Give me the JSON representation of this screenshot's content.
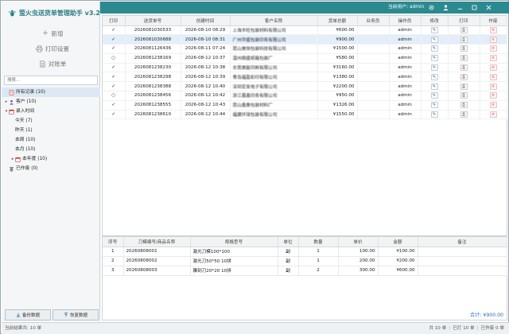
{
  "app": {
    "title": "萤火虫送货单管理助手 v3.2",
    "current_user_label": "当前用户: admin"
  },
  "sidebar": {
    "new_label": "新增",
    "print_settings_label": "打印设置",
    "statement_label": "对账单",
    "search_placeholder": "搜索...",
    "tree": [
      {
        "label": "所有记录 (10)",
        "level": 0,
        "icon": "note-icon",
        "twisty": "",
        "selected": true
      },
      {
        "label": "客户 (10)",
        "level": 0,
        "icon": "person-icon",
        "twisty": "▸",
        "selected": false
      },
      {
        "label": "录入时间",
        "level": 0,
        "icon": "calendar-icon",
        "twisty": "▾",
        "selected": false
      },
      {
        "label": "今天 (7)",
        "level": 1,
        "icon": "",
        "twisty": "",
        "selected": false
      },
      {
        "label": "昨天 (1)",
        "level": 1,
        "icon": "",
        "twisty": "",
        "selected": false
      },
      {
        "label": "本周 (10)",
        "level": 1,
        "icon": "",
        "twisty": "",
        "selected": false
      },
      {
        "label": "本月 (10)",
        "level": 1,
        "icon": "",
        "twisty": "",
        "selected": false
      },
      {
        "label": "本年度 (10)",
        "level": 1,
        "icon": "calendar-icon",
        "twisty": "▸",
        "selected": false
      },
      {
        "label": "已作废 (0)",
        "level": 0,
        "icon": "trash-icon",
        "twisty": "",
        "selected": false
      }
    ],
    "backup_label": "备份数据",
    "restore_label": "恢复数据"
  },
  "main_table": {
    "columns": [
      "打印",
      "送货单号",
      "创建时间",
      "客户名称",
      "货单总额",
      "业务员",
      "操作员",
      "修改",
      "打印",
      "作废"
    ],
    "rows": [
      {
        "printed": "✓",
        "no": "2026081030533",
        "time": "2026-08-10 08:29",
        "customer": "上海丰旺包装材料有限公司",
        "amount": "¥600.00",
        "sales": "",
        "operator": "admin",
        "highlight": false
      },
      {
        "printed": "✓",
        "no": "2026081030688",
        "time": "2026-08-10 08:31",
        "customer": "广州华盛包装印务有限公司",
        "amount": "¥900.00",
        "sales": "",
        "operator": "admin",
        "highlight": true
      },
      {
        "printed": "✓",
        "no": "2026081126436",
        "time": "2026-08-11 07:24",
        "customer": "昆山美恒包装科技有限公司",
        "amount": "¥1500.00",
        "sales": "",
        "operator": "admin",
        "highlight": false
      },
      {
        "printed": "○",
        "no": "2026081238169",
        "time": "2026-08-12 10:37",
        "customer": "温州鼎盛纸箱包装厂",
        "amount": "¥580.00",
        "sales": "",
        "operator": "admin",
        "highlight": false
      },
      {
        "printed": "✓",
        "no": "2026081238230",
        "time": "2026-08-12 10:38",
        "customer": "东莞美能印刷有限公司",
        "amount": "¥3160.00",
        "sales": "",
        "operator": "admin",
        "highlight": false
      },
      {
        "printed": "✓",
        "no": "2026081238298",
        "time": "2026-08-12 10:39",
        "customer": "青岛福盈彩印有限公司",
        "amount": "¥1380.00",
        "sales": "",
        "operator": "admin",
        "highlight": false
      },
      {
        "printed": "✓",
        "no": "2026081238388",
        "time": "2026-08-12 10:40",
        "customer": "深圳宏发电子有限公司",
        "amount": "¥2200.00",
        "sales": "",
        "operator": "admin",
        "highlight": false
      },
      {
        "printed": "○",
        "no": "2026081238456",
        "time": "2026-08-12 10:42",
        "customer": "浙江嘉鑫印务有限公司",
        "amount": "¥950.00",
        "sales": "",
        "operator": "admin",
        "highlight": false
      },
      {
        "printed": "✓",
        "no": "2026081238555",
        "time": "2026-08-12 10:43",
        "customer": "昆山鑫泰包装材料厂",
        "amount": "¥1326.00",
        "sales": "",
        "operator": "admin",
        "highlight": false
      },
      {
        "printed": "✓",
        "no": "2026081238610",
        "time": "2026-08-12 10:44",
        "customer": "福建环球包装有限公司",
        "amount": "¥1550.00",
        "sales": "",
        "operator": "admin",
        "highlight": false
      }
    ]
  },
  "detail_table": {
    "columns": [
      "序号",
      "刀模编号/商品名称",
      "规格型号",
      "单位",
      "数量",
      "单价",
      "金额",
      "备注"
    ],
    "rows": [
      {
        "idx": "1",
        "code": "20260808001",
        "spec": "激光刀模100*100",
        "unit": "副",
        "qty": "1",
        "price": "100.00",
        "amount": "¥100.00",
        "note": ""
      },
      {
        "idx": "2",
        "code": "20260808002",
        "spec": "激光刀50*50 10拼",
        "unit": "副",
        "qty": "1",
        "price": "200.00",
        "amount": "¥200.00",
        "note": ""
      },
      {
        "idx": "3",
        "code": "20260808003",
        "spec": "雕刻刀20*20 10拼",
        "unit": "副",
        "qty": "2",
        "price": "300.00",
        "amount": "¥600.00",
        "note": ""
      }
    ],
    "total_label": "合计: ¥900.00"
  },
  "status": {
    "left": "当前结果共: 10 单",
    "page": "共 10 单",
    "printed": "已打 10 单",
    "voided": "已作废 0 单"
  },
  "colors": {
    "accent": "#2b8a90",
    "brand_text": "#2a7e84",
    "selection": "#dce9f5",
    "row_highlight": "#e3eefa",
    "total_text": "#2a6fb4",
    "delete_red": "#d94c4c"
  }
}
